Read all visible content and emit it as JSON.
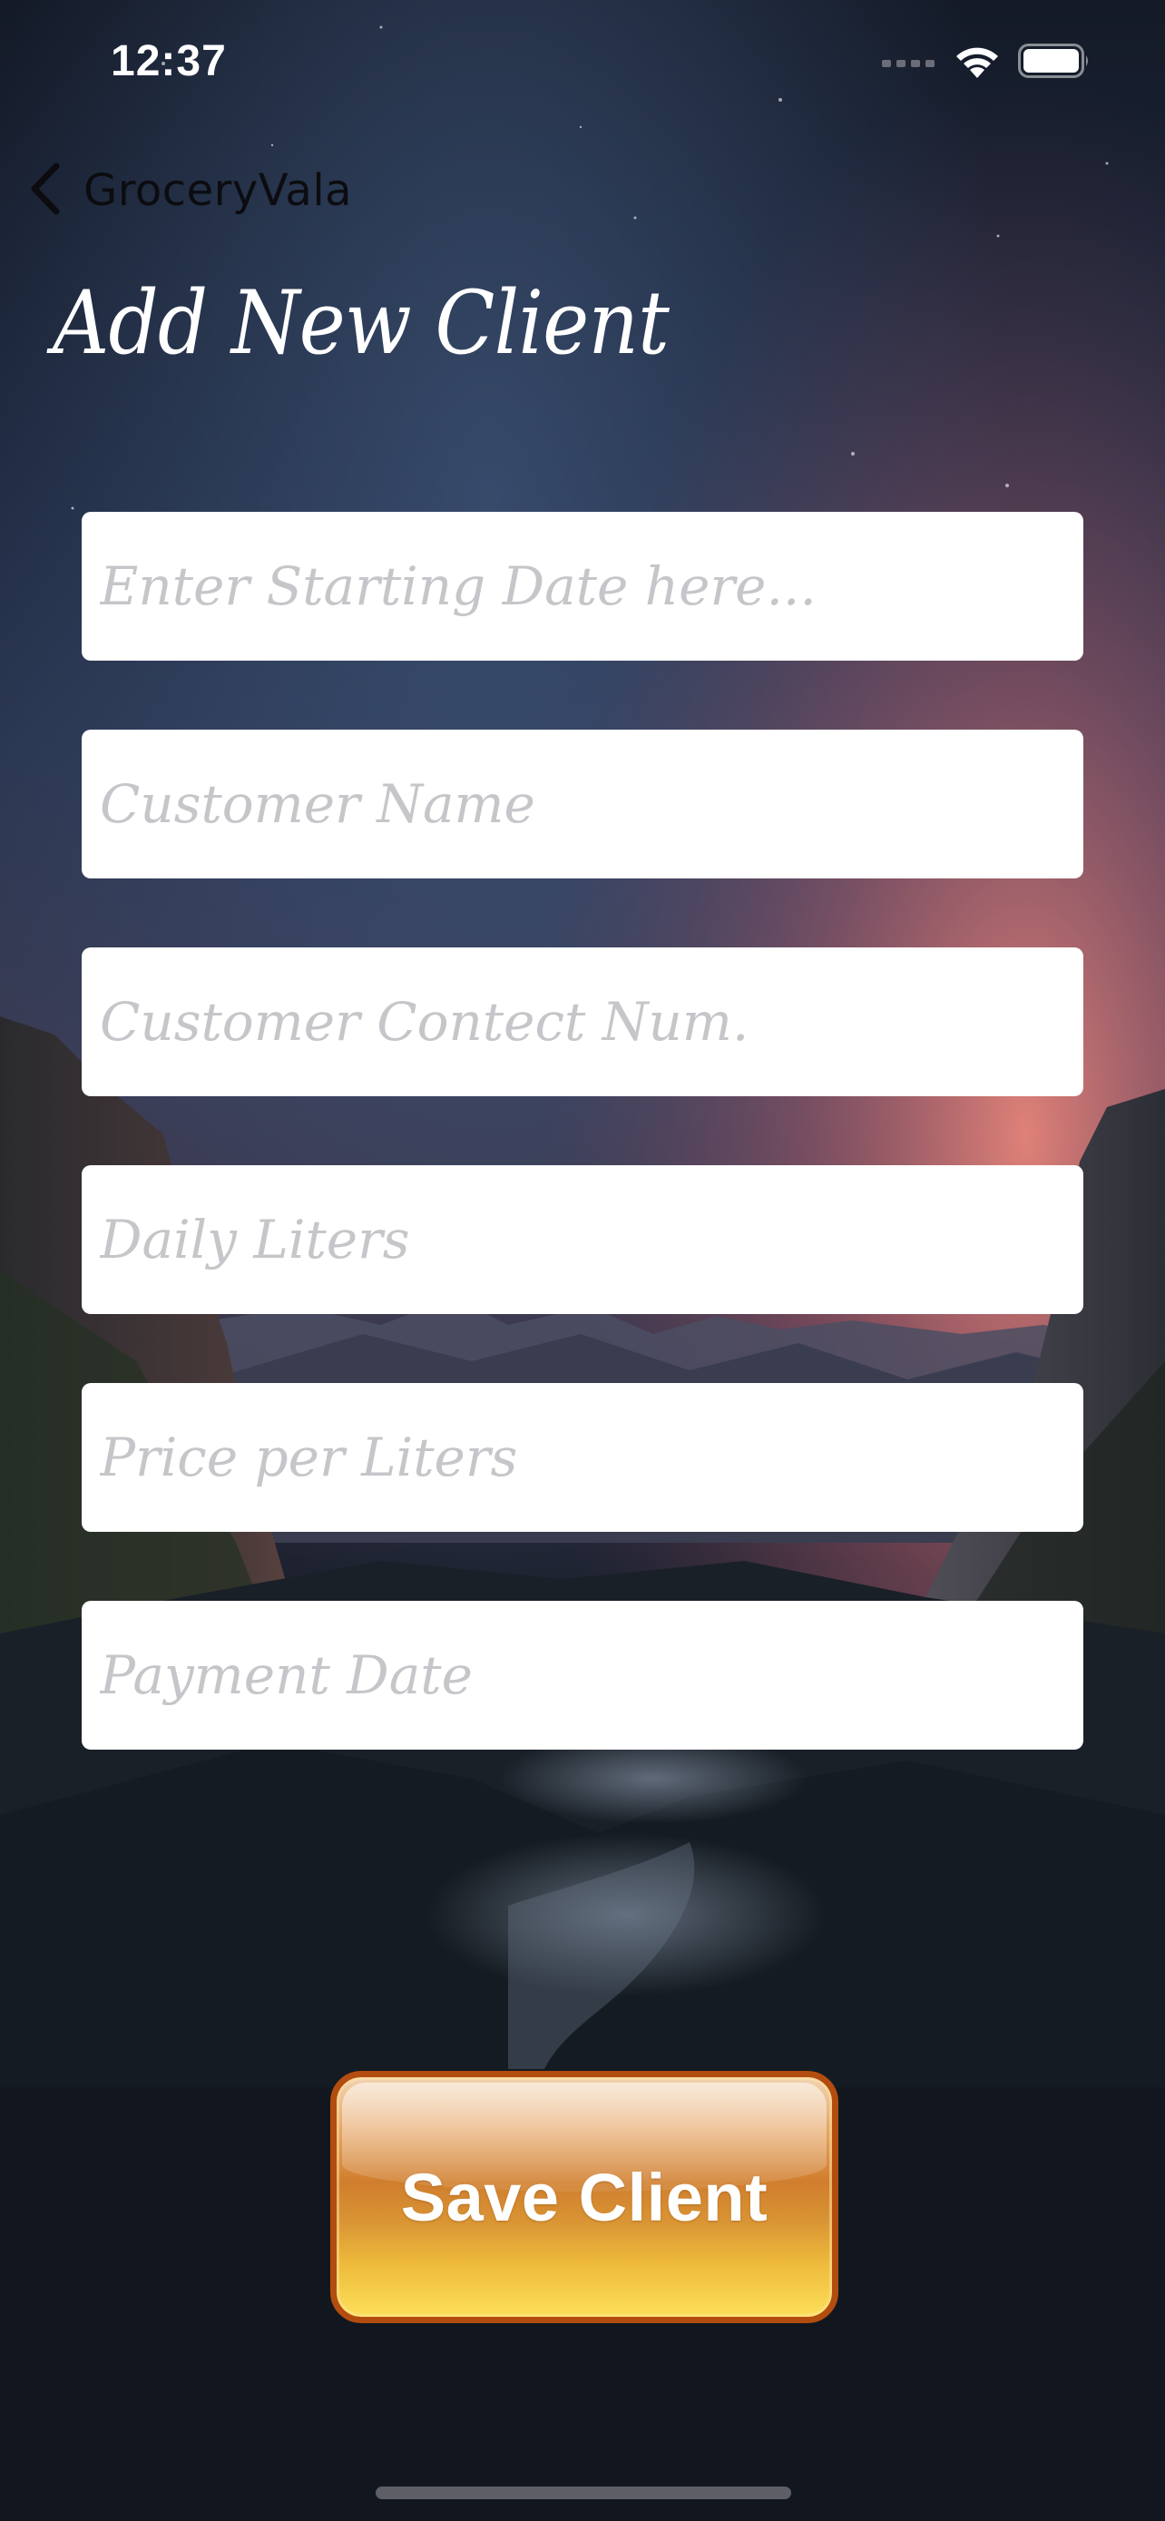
{
  "status_bar": {
    "time": "12:37",
    "icons": [
      "cellular-signal-icon",
      "wifi-icon",
      "battery-icon"
    ]
  },
  "nav": {
    "back_label": "GroceryVala",
    "back_icon": "chevron-left-icon"
  },
  "page": {
    "title": "Add New Client"
  },
  "form": {
    "fields": [
      {
        "placeholder": "Enter Starting Date here...",
        "value": ""
      },
      {
        "placeholder": "Customer Name",
        "value": ""
      },
      {
        "placeholder": "Customer Contect Num.",
        "value": ""
      },
      {
        "placeholder": "Daily Liters",
        "value": ""
      },
      {
        "placeholder": "Price per Liters",
        "value": ""
      },
      {
        "placeholder": "Payment Date",
        "value": ""
      }
    ],
    "save_label": "Save Client"
  },
  "colors": {
    "field_background": "#ffffff",
    "placeholder_text": "#c6c6ca",
    "button_border": "#b34d0f",
    "button_gold": "#fde05a",
    "sky_glow": "#e8857a"
  }
}
